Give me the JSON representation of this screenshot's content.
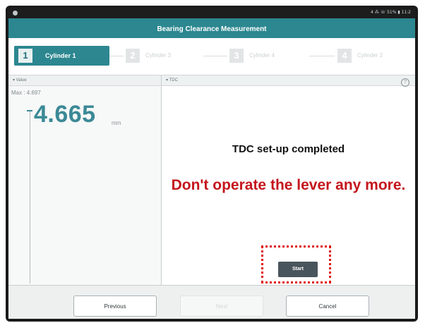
{
  "app": {
    "title": "Bearing Clearance Measurement",
    "status_right": "4 ⁂ ☏ 51% ▮ 11:2"
  },
  "steps": [
    {
      "num": "1",
      "label": "Cylinder 1",
      "active": true
    },
    {
      "num": "2",
      "label": "Cylinder 3",
      "active": false
    },
    {
      "num": "3",
      "label": "Cylinder 4",
      "active": false
    },
    {
      "num": "4",
      "label": "Cylinder 2",
      "active": false
    }
  ],
  "value_panel": {
    "header": "▾ Value",
    "max": "Max : 4.697",
    "value": "4.665",
    "unit": "mm"
  },
  "tdc_panel": {
    "header": "▾ TDC",
    "help": "?",
    "message1": "TDC set-up completed",
    "message2": "Don't operate the lever any more.",
    "start": "Start"
  },
  "footer": {
    "previous": "Previous",
    "next": "Next",
    "cancel": "Cancel"
  },
  "icons": {
    "help": "help-icon",
    "camera": "camera-dot-icon"
  },
  "colors": {
    "teal": "#2c8790",
    "value": "#3b8a96",
    "warning": "#c4161c",
    "highlight": "#e01414",
    "start_btn": "#49555c"
  }
}
